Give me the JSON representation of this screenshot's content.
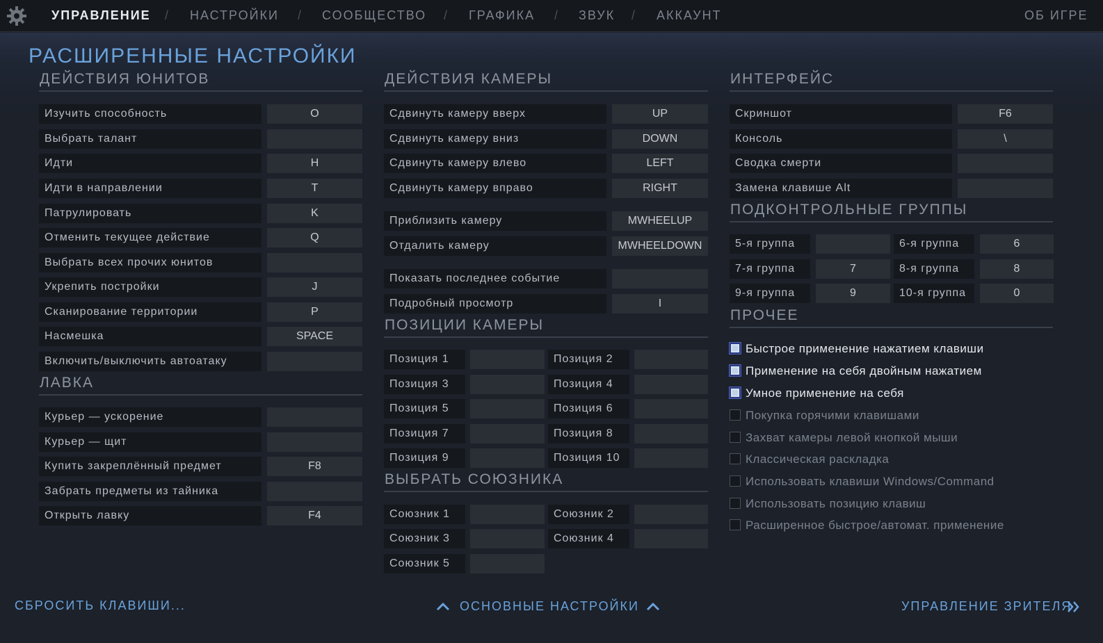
{
  "nav": {
    "tabs": [
      "УПРАВЛЕНИЕ",
      "НАСТРОЙКИ",
      "СООБЩЕСТВО",
      "ГРАФИКА",
      "ЗВУК",
      "АККАУНТ"
    ],
    "sep": "/",
    "about": "ОБ ИГРЕ"
  },
  "page_title": "РАСШИРЕННЫЕ НАСТРОЙКИ",
  "unit_actions": {
    "title": "ДЕЙСТВИЯ ЮНИТОВ",
    "rows": [
      {
        "label": "Изучить способность",
        "key": "O"
      },
      {
        "label": "Выбрать талант",
        "key": ""
      },
      {
        "label": "Идти",
        "key": "H"
      },
      {
        "label": "Идти в направлении",
        "key": "T"
      },
      {
        "label": "Патрулировать",
        "key": "K"
      },
      {
        "label": "Отменить текущее действие",
        "key": "Q"
      },
      {
        "label": "Выбрать всех прочих юнитов",
        "key": ""
      },
      {
        "label": "Укрепить постройки",
        "key": "J"
      },
      {
        "label": "Сканирование территории",
        "key": "P"
      },
      {
        "label": "Насмешка",
        "key": "SPACE"
      },
      {
        "label": "Включить/выключить автоатаку",
        "key": ""
      }
    ]
  },
  "shop": {
    "title": "ЛАВКА",
    "rows": [
      {
        "label": "Курьер — ускорение",
        "key": ""
      },
      {
        "label": "Курьер — щит",
        "key": ""
      },
      {
        "label": "Купить закреплённый предмет",
        "key": "F8"
      },
      {
        "label": "Забрать предметы из тайника",
        "key": ""
      },
      {
        "label": "Открыть лавку",
        "key": "F4"
      }
    ]
  },
  "camera_actions": {
    "title": "ДЕЙСТВИЯ КАМЕРЫ",
    "rows": [
      {
        "label": "Сдвинуть камеру вверх",
        "key": "UP"
      },
      {
        "label": "Сдвинуть камеру вниз",
        "key": "DOWN"
      },
      {
        "label": "Сдвинуть камеру влево",
        "key": "LEFT"
      },
      {
        "label": "Сдвинуть камеру вправо",
        "key": "RIGHT"
      },
      {
        "label": "Приблизить камеру",
        "key": "MWHEELUP"
      },
      {
        "label": "Отдалить камеру",
        "key": "MWHEELDOWN"
      },
      {
        "label": "Показать последнее событие",
        "key": ""
      },
      {
        "label": "Подробный просмотр",
        "key": "I"
      }
    ]
  },
  "camera_positions": {
    "title": "ПОЗИЦИИ КАМЕРЫ",
    "rows": [
      {
        "label": "Позиция 1",
        "key": ""
      },
      {
        "label": "Позиция 2",
        "key": ""
      },
      {
        "label": "Позиция 3",
        "key": ""
      },
      {
        "label": "Позиция 4",
        "key": ""
      },
      {
        "label": "Позиция 5",
        "key": ""
      },
      {
        "label": "Позиция 6",
        "key": ""
      },
      {
        "label": "Позиция 7",
        "key": ""
      },
      {
        "label": "Позиция 8",
        "key": ""
      },
      {
        "label": "Позиция 9",
        "key": ""
      },
      {
        "label": "Позиция 10",
        "key": ""
      }
    ]
  },
  "select_ally": {
    "title": "ВЫБРАТЬ СОЮЗНИКА",
    "rows": [
      {
        "label": "Союзник 1",
        "key": ""
      },
      {
        "label": "Союзник 2",
        "key": ""
      },
      {
        "label": "Союзник 3",
        "key": ""
      },
      {
        "label": "Союзник 4",
        "key": ""
      },
      {
        "label": "Союзник 5",
        "key": ""
      }
    ]
  },
  "interface": {
    "title": "ИНТЕРФЕЙС",
    "rows": [
      {
        "label": "Скриншот",
        "key": "F6"
      },
      {
        "label": "Консоль",
        "key": "\\"
      },
      {
        "label": "Сводка смерти",
        "key": ""
      },
      {
        "label": "Замена клавише Alt",
        "key": ""
      }
    ]
  },
  "control_groups": {
    "title": "ПОДКОНТРОЛЬНЫЕ ГРУППЫ",
    "rows": [
      {
        "label": "5-я группа",
        "key": ""
      },
      {
        "label": "6-я группа",
        "key": "6"
      },
      {
        "label": "7-я группа",
        "key": "7"
      },
      {
        "label": "8-я группа",
        "key": "8"
      },
      {
        "label": "9-я группа",
        "key": "9"
      },
      {
        "label": "10-я группа",
        "key": "0"
      }
    ]
  },
  "other": {
    "title": "ПРОЧЕЕ",
    "options": [
      {
        "label": "Быстрое применение нажатием клавиши",
        "checked": true
      },
      {
        "label": "Применение на себя двойным нажатием",
        "checked": true
      },
      {
        "label": "Умное применение на себя",
        "checked": true
      },
      {
        "label": "Покупка горячими клавишами",
        "checked": false
      },
      {
        "label": "Захват камеры левой кнопкой мыши",
        "checked": false
      },
      {
        "label": "Классическая раскладка",
        "checked": false
      },
      {
        "label": "Использовать клавиши Windows/Command",
        "checked": false
      },
      {
        "label": "Использовать позицию клавиш",
        "checked": false
      },
      {
        "label": "Расширенное быстрое/автомат. применение",
        "checked": false
      }
    ]
  },
  "footer": {
    "reset": "СБРОСИТЬ КЛАВИШИ...",
    "basic": "ОСНОВНЫЕ НАСТРОЙКИ",
    "spectator": "УПРАВЛЕНИЕ ЗРИТЕЛЯ"
  },
  "colors": {
    "accent": "#6aa2db",
    "label_bg": "#15181d",
    "key_bg": "#2a2e35",
    "background": "#1c212a"
  }
}
